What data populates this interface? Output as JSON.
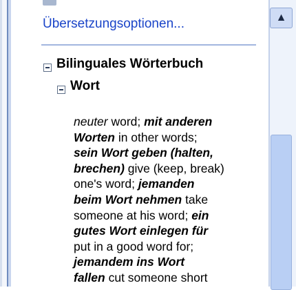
{
  "pane": {
    "link_label": "Übersetzungsoptionen...",
    "sections": [
      {
        "label": "Bilinguales Wörterbuch"
      },
      {
        "label": "Wort"
      }
    ],
    "entry_lines": [
      [
        {
          "t": "neuter",
          "s": "it"
        },
        {
          "t": " word; ",
          "s": ""
        },
        {
          "t": "mit anderen",
          "s": "bi"
        }
      ],
      [
        {
          "t": "Worten",
          "s": "bi"
        },
        {
          "t": " in other words;",
          "s": ""
        }
      ],
      [
        {
          "t": "sein Wort geben (halten,",
          "s": "bi"
        }
      ],
      [
        {
          "t": "brechen)",
          "s": "bi"
        },
        {
          "t": " give (keep, break)",
          "s": ""
        }
      ],
      [
        {
          "t": "one's word; ",
          "s": ""
        },
        {
          "t": "jemanden",
          "s": "bi"
        }
      ],
      [
        {
          "t": "beim Wort nehmen",
          "s": "bi"
        },
        {
          "t": " take",
          "s": ""
        }
      ],
      [
        {
          "t": "someone at his word; ",
          "s": ""
        },
        {
          "t": "ein",
          "s": "bi"
        }
      ],
      [
        {
          "t": "gutes Wort einlegen für",
          "s": "bi"
        }
      ],
      [
        {
          "t": "put in a good word for;",
          "s": ""
        }
      ],
      [
        {
          "t": "jemandem ins Wort",
          "s": "bi"
        }
      ],
      [
        {
          "t": "fallen",
          "s": "bi"
        },
        {
          "t": " cut someone short",
          "s": ""
        }
      ]
    ]
  },
  "scrollbar": {
    "up_arrow_glyph": "▲"
  }
}
